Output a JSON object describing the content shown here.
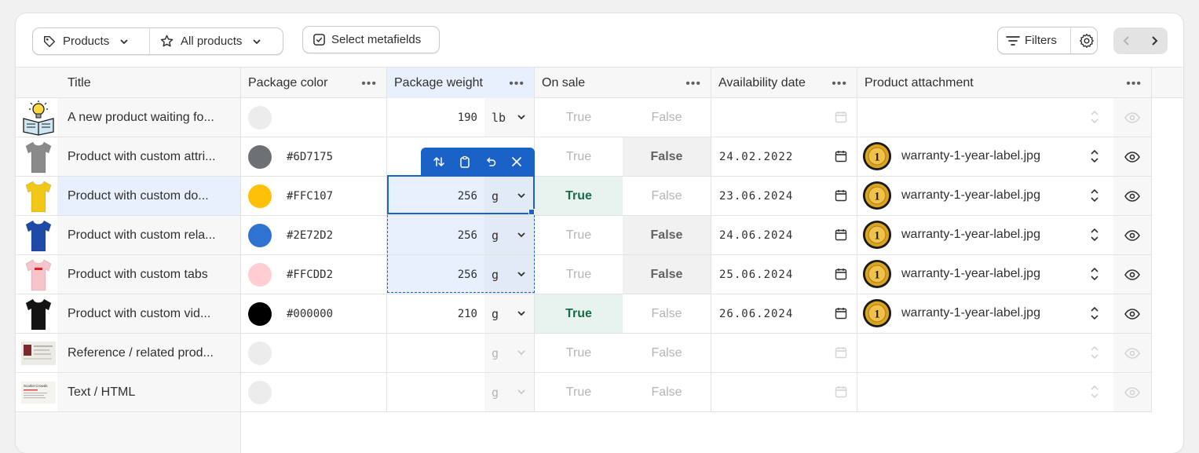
{
  "toolbar": {
    "resource_label": "Products",
    "view_label": "All products",
    "metafields_label": "Select metafields",
    "filters_label": "Filters"
  },
  "columns": {
    "title": "Title",
    "color": "Package color",
    "weight": "Package weight",
    "on_sale": "On sale",
    "availability": "Availability date",
    "attachment": "Product attachment"
  },
  "rows": [
    {
      "title": "A new product waiting fo...",
      "hex": "",
      "weight": "190",
      "unit": "lb",
      "true": "True",
      "false": "False",
      "date": "",
      "file": "",
      "thumb": "lightbulb-book"
    },
    {
      "title": "Product with custom attri...",
      "hex": "#6D7175",
      "weight": "",
      "unit": "",
      "true": "True",
      "false": "False",
      "date": "24.02.2022",
      "file": "warranty-1-year-label.jpg",
      "thumb": "tshirt-gray"
    },
    {
      "title": "Product with custom do...",
      "hex": "#FFC107",
      "weight": "256",
      "unit": "g",
      "true": "True",
      "false": "False",
      "date": "23.06.2024",
      "file": "warranty-1-year-label.jpg",
      "thumb": "tshirt-yellow"
    },
    {
      "title": "Product with custom rela...",
      "hex": "#2E72D2",
      "weight": "256",
      "unit": "g",
      "true": "True",
      "false": "False",
      "date": "24.06.2024",
      "file": "warranty-1-year-label.jpg",
      "thumb": "tshirt-blue"
    },
    {
      "title": "Product with custom tabs",
      "hex": "#FFCDD2",
      "weight": "256",
      "unit": "g",
      "true": "True",
      "false": "False",
      "date": "25.06.2024",
      "file": "warranty-1-year-label.jpg",
      "thumb": "tshirt-pink"
    },
    {
      "title": "Product with custom vid...",
      "hex": "#000000",
      "weight": "210",
      "unit": "g",
      "true": "True",
      "false": "False",
      "date": "26.06.2024",
      "file": "warranty-1-year-label.jpg",
      "thumb": "tshirt-black"
    },
    {
      "title": "Reference / related prod...",
      "hex": "",
      "weight": "",
      "unit": "g",
      "true": "True",
      "false": "False",
      "date": "",
      "file": "",
      "thumb": "screenshot"
    },
    {
      "title": "Text / HTML",
      "hex": "",
      "weight": "",
      "unit": "g",
      "true": "True",
      "false": "False",
      "date": "",
      "file": "",
      "thumb": "document"
    }
  ],
  "medal_text": "1",
  "thumb_text": {
    "document_title": "Scarlet Crowds"
  },
  "colors": {
    "selection": "#1a62c6",
    "selected_bg": "#e8f0fd",
    "true_green": "#1a6b4a",
    "true_bg": "#e8f3ef"
  }
}
